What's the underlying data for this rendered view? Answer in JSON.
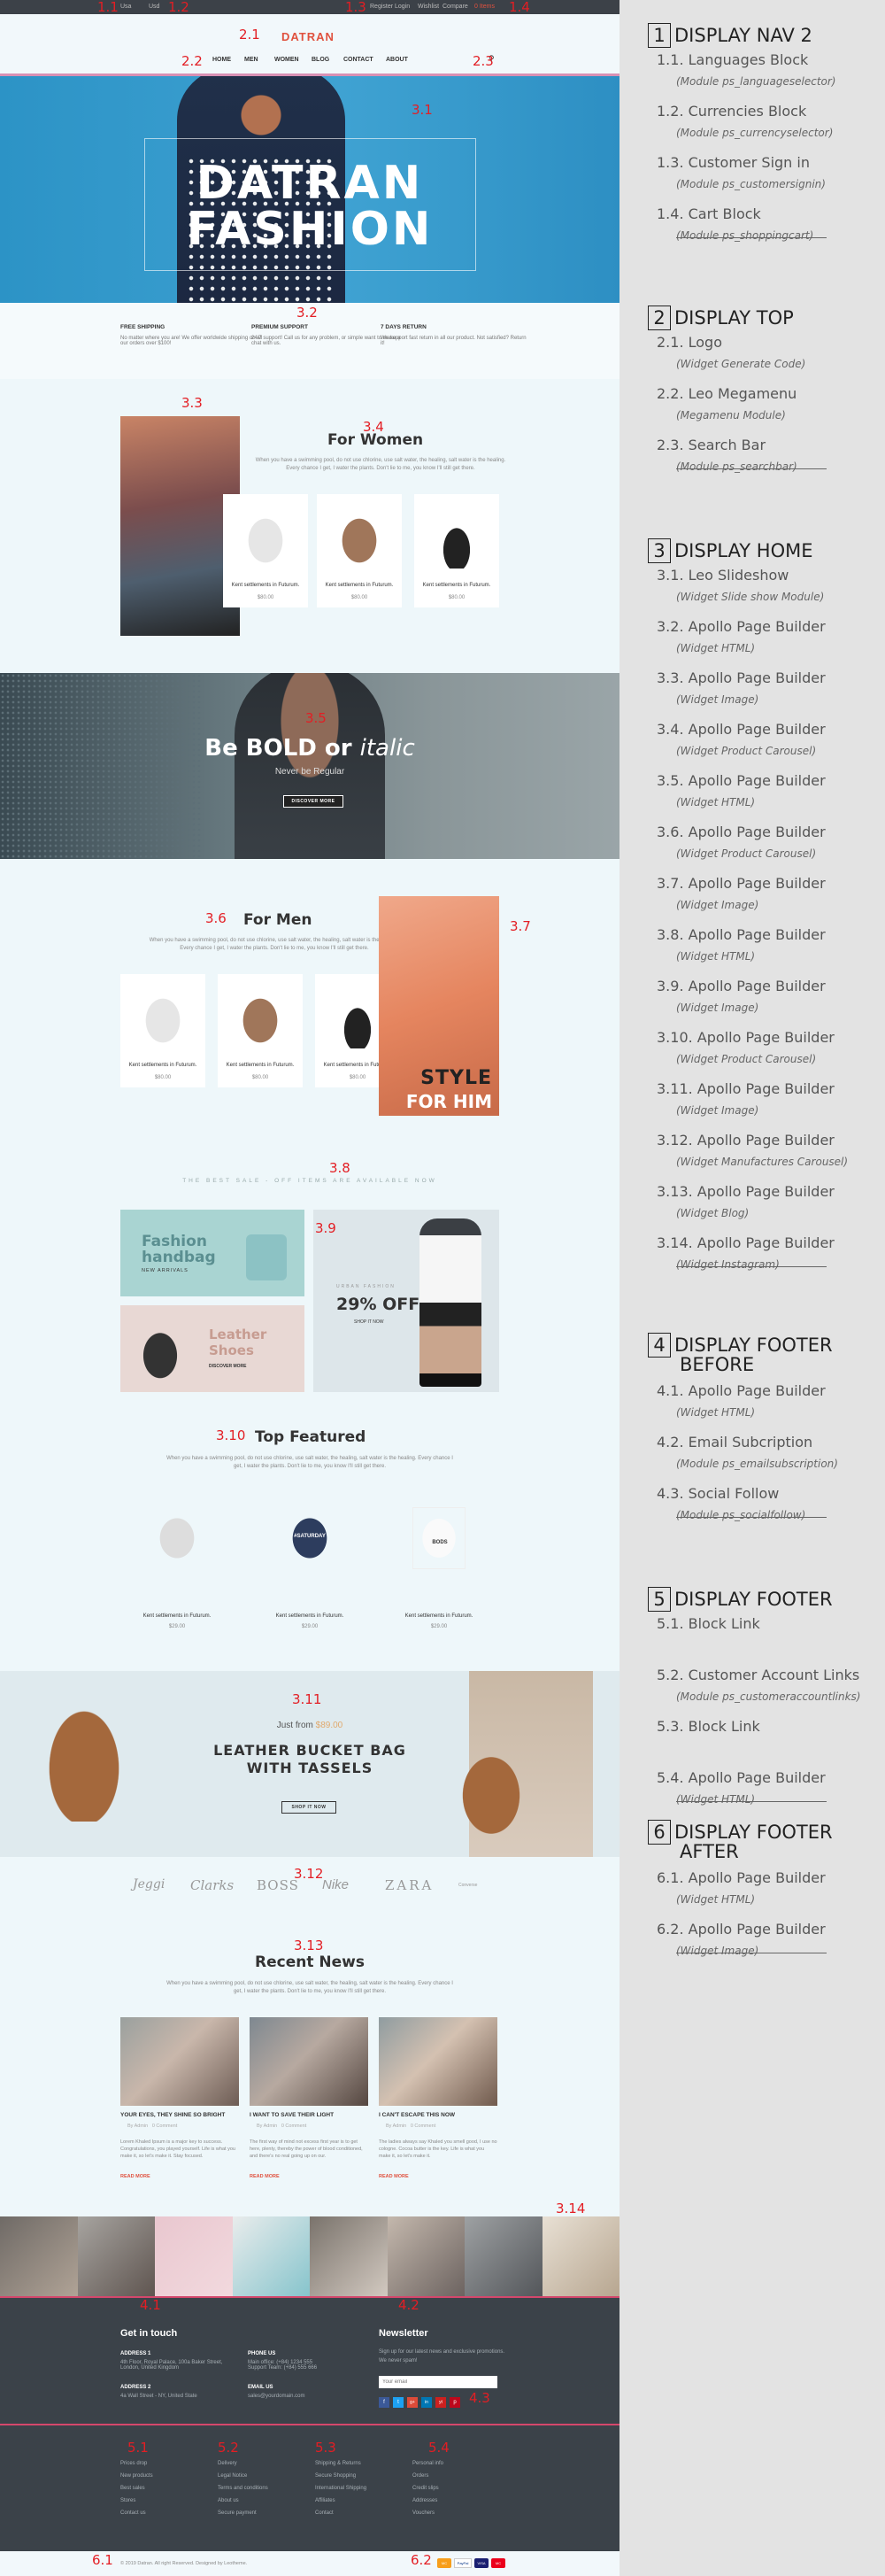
{
  "topbar": {
    "lang": "Usa",
    "currency": "Usd",
    "links": [
      "Register",
      "Login",
      "Wishlist",
      "Compare"
    ],
    "cart": "0 Items"
  },
  "markers": {
    "m11": "1.1",
    "m12": "1.2",
    "m13": "1.3",
    "m14": "1.4",
    "m21": "2.1",
    "m22": "2.2",
    "m23": "2.3",
    "m31": "3.1",
    "m32": "3.2",
    "m33": "3.3",
    "m34": "3.4",
    "m35": "3.5",
    "m36": "3.6",
    "m37": "3.7",
    "m38": "3.8",
    "m39": "3.9",
    "m310": "3.10",
    "m311": "3.11",
    "m312": "3.12",
    "m313": "3.13",
    "m314": "3.14",
    "m41": "4.1",
    "m42": "4.2",
    "m43": "4.3",
    "m51": "5.1",
    "m52": "5.2",
    "m53": "5.3",
    "m54": "5.4",
    "m61": "6.1",
    "m62": "6.2"
  },
  "header": {
    "logo": "DATRAN",
    "nav": [
      "HOME",
      "MEN",
      "WOMEN",
      "BLOG",
      "CONTACT",
      "ABOUT"
    ]
  },
  "hero": {
    "line1": "DATRAN",
    "line2": "FASHION"
  },
  "features": [
    {
      "title": "FREE SHIPPING",
      "text": "No matter where you are! We offer worldwide shipping on all our orders over $100!"
    },
    {
      "title": "PREMIUM SUPPORT",
      "text": "24/7 support! Call us for any problem, or simple want to make a chat with us."
    },
    {
      "title": "7 DAYS RETURN",
      "text": "We support fast return in all our product. Not satisfied? Return it!"
    }
  ],
  "women": {
    "title": "For Women",
    "desc1": "When you have a swimming pool, do not use chlorine, use salt water, the healing, salt water is the healing.",
    "desc2": "Every chance I get, I water the plants. Don't lie to me, you know I'll still get there.",
    "products": [
      {
        "name": "Kent settlements in Futurum.",
        "price": "$80.00"
      },
      {
        "name": "Kent settlements in Futurum.",
        "price": "$80.00"
      },
      {
        "name": "Kent settlements in Futurum.",
        "price": "$80.00"
      }
    ]
  },
  "bold": {
    "title_a": "Be BOLD or ",
    "title_b": "italic",
    "sub": "Never be Regular",
    "button": "DISCOVER MORE"
  },
  "men": {
    "title": "For Men",
    "desc1": "When you have a swimming pool, do not use chlorine, use salt water, the healing, salt water is the healing.",
    "desc2": "Every chance I get, I water the plants. Don't lie to me, you know I'll still get there.",
    "products": [
      {
        "name": "Kent settlements in Futurum.",
        "price": "$80.00"
      },
      {
        "name": "Kent settlements in Futurum.",
        "price": "$80.00"
      },
      {
        "name": "Kent settlements in Futurum.",
        "price": "$80.00"
      }
    ],
    "banner_line1": "STYLE",
    "banner_line2": "FOR HIM"
  },
  "bestsale": {
    "text": "THE BEST SALE - OFF ITEMS ARE AVAILABLE NOW"
  },
  "promo": {
    "handbag1": "Fashion",
    "handbag2": "handbag",
    "handbag_sub": "NEW ARRIVALS",
    "shoes1": "Leather",
    "shoes2": "Shoes",
    "shoes_btn": "DISCOVER MORE",
    "off_label": "URBAN FASHION",
    "off": "29% OFF",
    "off_btn": "SHOP IT NOW"
  },
  "featured": {
    "title": "Top Featured",
    "desc1": "When you have a swimming pool, do not use chlorine, use salt water, the healing, salt water is the healing. Every chance I",
    "desc2": "get, I water the plants. Don't lie to me, you know I'll still get there.",
    "tshirt": "#SATURDAY",
    "tshirt3": "BODS",
    "products": [
      {
        "name": "Kent settlements in Futurum.",
        "price": "$29.00"
      },
      {
        "name": "Kent settlements in Futurum.",
        "price": "$29.00"
      },
      {
        "name": "Kent settlements in Futurum.",
        "price": "$29.00"
      }
    ]
  },
  "bucket": {
    "just": "Just from",
    "price": "$89.00",
    "line1": "LEATHER BUCKET BAG",
    "line2": "WITH TASSELS",
    "button": "SHOP IT NOW"
  },
  "brands": [
    "Jeggi",
    "Clarks",
    "BOSS",
    "Nike",
    "ZARA",
    "Converse"
  ],
  "news": {
    "title": "Recent News",
    "desc1": "When you have a swimming pool, do not use chlorine, use salt water, the healing, salt water is the healing. Every chance I",
    "desc2": "get, I water the plants. Don't lie to me, you know I'll still get there.",
    "items": [
      {
        "title": "YOUR EYES, THEY SHINE SO BRIGHT",
        "author": "By Admin",
        "comments": "0 Comment",
        "text": "Lorem Khaled Ipsum is a major key to success. Congratulations, you played yourself. Life is what you make it, so let's make it. Stay focused.",
        "more": "READ MORE"
      },
      {
        "title": "I WANT TO SAVE THEIR LIGHT",
        "author": "By Admin",
        "comments": "0 Comment",
        "text": "The first way of mind not excess first year is to get here, plenty, thereby the power of blood conditioned, and there's no real going up on our.",
        "more": "READ MORE"
      },
      {
        "title": "I CAN'T ESCAPE THIS NOW",
        "author": "By Admin",
        "comments": "0 Comment",
        "text": "The ladies always say Khaled you smell good, I use no cologne. Cocoa butter is the key. Life is what you make it, so let's make it.",
        "more": "READ MORE"
      }
    ]
  },
  "footer": {
    "contact_title": "Get in touch",
    "addr1_t": "ADDRESS 1",
    "addr1": "4th Floor, Royal Palace, 100a Baker Street, London, United Kingdom",
    "addr2_t": "ADDRESS 2",
    "addr2": "4a Wall Street - NY, United State",
    "phone_t": "PHONE US",
    "phone": "Main office: (+84) 1234 555\nSupport Team: (+84) 555 666",
    "email_t": "EMAIL US",
    "email": "sales@yourdomain.com",
    "newsletter_title": "Newsletter",
    "newsletter_text": "Sign up for our latest news and exclusive promotions.",
    "newsletter_text2": "We never spam!",
    "newsletter_placeholder": "Your email",
    "social": [
      "f",
      "t",
      "g+",
      "in",
      "yt",
      "p"
    ],
    "col1": [
      "Prices drop",
      "New products",
      "Best sales",
      "Stores",
      "Contact us"
    ],
    "col2": [
      "Delivery",
      "Legal Notice",
      "Terms and conditions",
      "About us",
      "Secure payment"
    ],
    "col3": [
      "Shipping & Returns",
      "Secure Shopping",
      "International Shipping",
      "Affiliates",
      "Contact"
    ],
    "col4": [
      "Personal info",
      "Orders",
      "Credit slips",
      "Addresses",
      "Vouchers"
    ],
    "copyright": "© 2019 Datran. All right Reserved. Designed by Leotheme.",
    "payments": [
      "MC",
      "PayPal",
      "VISA",
      "MC"
    ]
  },
  "right": [
    {
      "num": "1",
      "title": "DISPLAY NAV 2",
      "items": [
        {
          "label": "1.1. Languages Block",
          "sub": "(Module ps_languageselector)"
        },
        {
          "label": "1.2. Currencies Block",
          "sub": "(Module ps_currencyselector)"
        },
        {
          "label": "1.3. Customer Sign in",
          "sub": "(Module ps_customersignin)"
        },
        {
          "label": "1.4. Cart Block",
          "sub": "(Module ps_shoppingcart)"
        }
      ]
    },
    {
      "num": "2",
      "title": "DISPLAY TOP",
      "items": [
        {
          "label": "2.1. Logo",
          "sub": "(Widget Generate Code)"
        },
        {
          "label": "2.2. Leo Megamenu",
          "sub": "(Megamenu Module)"
        },
        {
          "label": "2.3. Search Bar",
          "sub": "(Module ps_searchbar)"
        }
      ]
    },
    {
      "num": "3",
      "title": "DISPLAY HOME",
      "items": [
        {
          "label": "3.1. Leo Slideshow",
          "sub": "(Widget Slide show Module)"
        },
        {
          "label": "3.2. Apollo Page Builder",
          "sub": "(Widget HTML)"
        },
        {
          "label": "3.3. Apollo Page Builder",
          "sub": "(Widget Image)"
        },
        {
          "label": "3.4. Apollo Page Builder",
          "sub": "(Widget Product Carousel)"
        },
        {
          "label": "3.5. Apollo Page Builder",
          "sub": "(Widget HTML)"
        },
        {
          "label": "3.6. Apollo Page Builder",
          "sub": "(Widget Product Carousel)"
        },
        {
          "label": "3.7. Apollo Page Builder",
          "sub": "(Widget Image)"
        },
        {
          "label": "3.8. Apollo Page Builder",
          "sub": "(Widget HTML)"
        },
        {
          "label": "3.9. Apollo Page Builder",
          "sub": "(Widget Image)"
        },
        {
          "label": "3.10. Apollo Page Builder",
          "sub": "(Widget Product Carousel)"
        },
        {
          "label": "3.11. Apollo Page Builder",
          "sub": "(Widget Image)"
        },
        {
          "label": "3.12. Apollo Page Builder",
          "sub": "(Widget Manufactures Carousel)"
        },
        {
          "label": "3.13. Apollo Page Builder",
          "sub": "(Widget Blog)"
        },
        {
          "label": "3.14. Apollo Page Builder",
          "sub": "(Widget Instagram)"
        }
      ]
    },
    {
      "num": "4",
      "title": "DISPLAY FOOTER",
      "title2": "BEFORE",
      "items": [
        {
          "label": "4.1. Apollo Page Builder",
          "sub": "(Widget HTML)"
        },
        {
          "label": "4.2. Email Subcription",
          "sub": "(Module ps_emailsubscription)"
        },
        {
          "label": "4.3. Social Follow",
          "sub": "(Module ps_socialfollow)"
        }
      ]
    },
    {
      "num": "5",
      "title": "DISPLAY FOOTER",
      "items": [
        {
          "label": "5.1. Block Link",
          "sub": ""
        },
        {
          "label": "5.2. Customer Account Links",
          "sub": "(Module ps_customeraccountlinks)"
        },
        {
          "label": "5.3. Block Link",
          "sub": ""
        },
        {
          "label": "5.4. Apollo Page Builder",
          "sub": "(Widget HTML)"
        }
      ]
    },
    {
      "num": "6",
      "title": "DISPLAY FOOTER",
      "title2": "AFTER",
      "items": [
        {
          "label": "6.1. Apollo Page Builder",
          "sub": "(Widget HTML)"
        },
        {
          "label": "6.2. Apollo Page Builder",
          "sub": "(Widget Image)"
        }
      ]
    }
  ]
}
